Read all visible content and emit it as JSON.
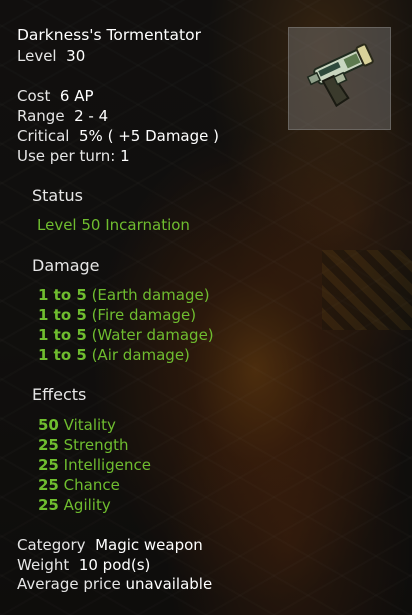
{
  "item": {
    "name": "Darkness's Tormentator",
    "level_label": "Level",
    "level_value": "30",
    "icon": "pistol-weapon-icon"
  },
  "stats": {
    "cost_label": "Cost",
    "cost_value": "6 AP",
    "range_label": "Range",
    "range_value": "2 - 4",
    "critical_label": "Critical",
    "critical_value": "5% ( +5 Damage )",
    "use_label": "Use per turn:",
    "use_value": "1"
  },
  "status": {
    "heading": "Status",
    "value": "Level 50 Incarnation"
  },
  "damage": {
    "heading": "Damage",
    "lines": [
      {
        "amount": "1 to 5",
        "type": "(Earth damage)"
      },
      {
        "amount": "1 to 5",
        "type": "(Fire damage)"
      },
      {
        "amount": "1 to 5",
        "type": "(Water damage)"
      },
      {
        "amount": "1 to 5",
        "type": "(Air damage)"
      }
    ]
  },
  "effects": {
    "heading": "Effects",
    "lines": [
      {
        "amount": "50",
        "stat": "Vitality"
      },
      {
        "amount": "25",
        "stat": "Strength"
      },
      {
        "amount": "25",
        "stat": "Intelligence"
      },
      {
        "amount": "25",
        "stat": "Chance"
      },
      {
        "amount": "25",
        "stat": "Agility"
      }
    ]
  },
  "footer": {
    "category_label": "Category",
    "category_value": "Magic weapon",
    "weight_label": "Weight",
    "weight_value": "10 pod(s)",
    "price_label": "Average price",
    "price_value": "unavailable"
  },
  "colors": {
    "green": "#6fbd2f",
    "text": "#e6e6e6",
    "panel": "#0a0a0a"
  }
}
